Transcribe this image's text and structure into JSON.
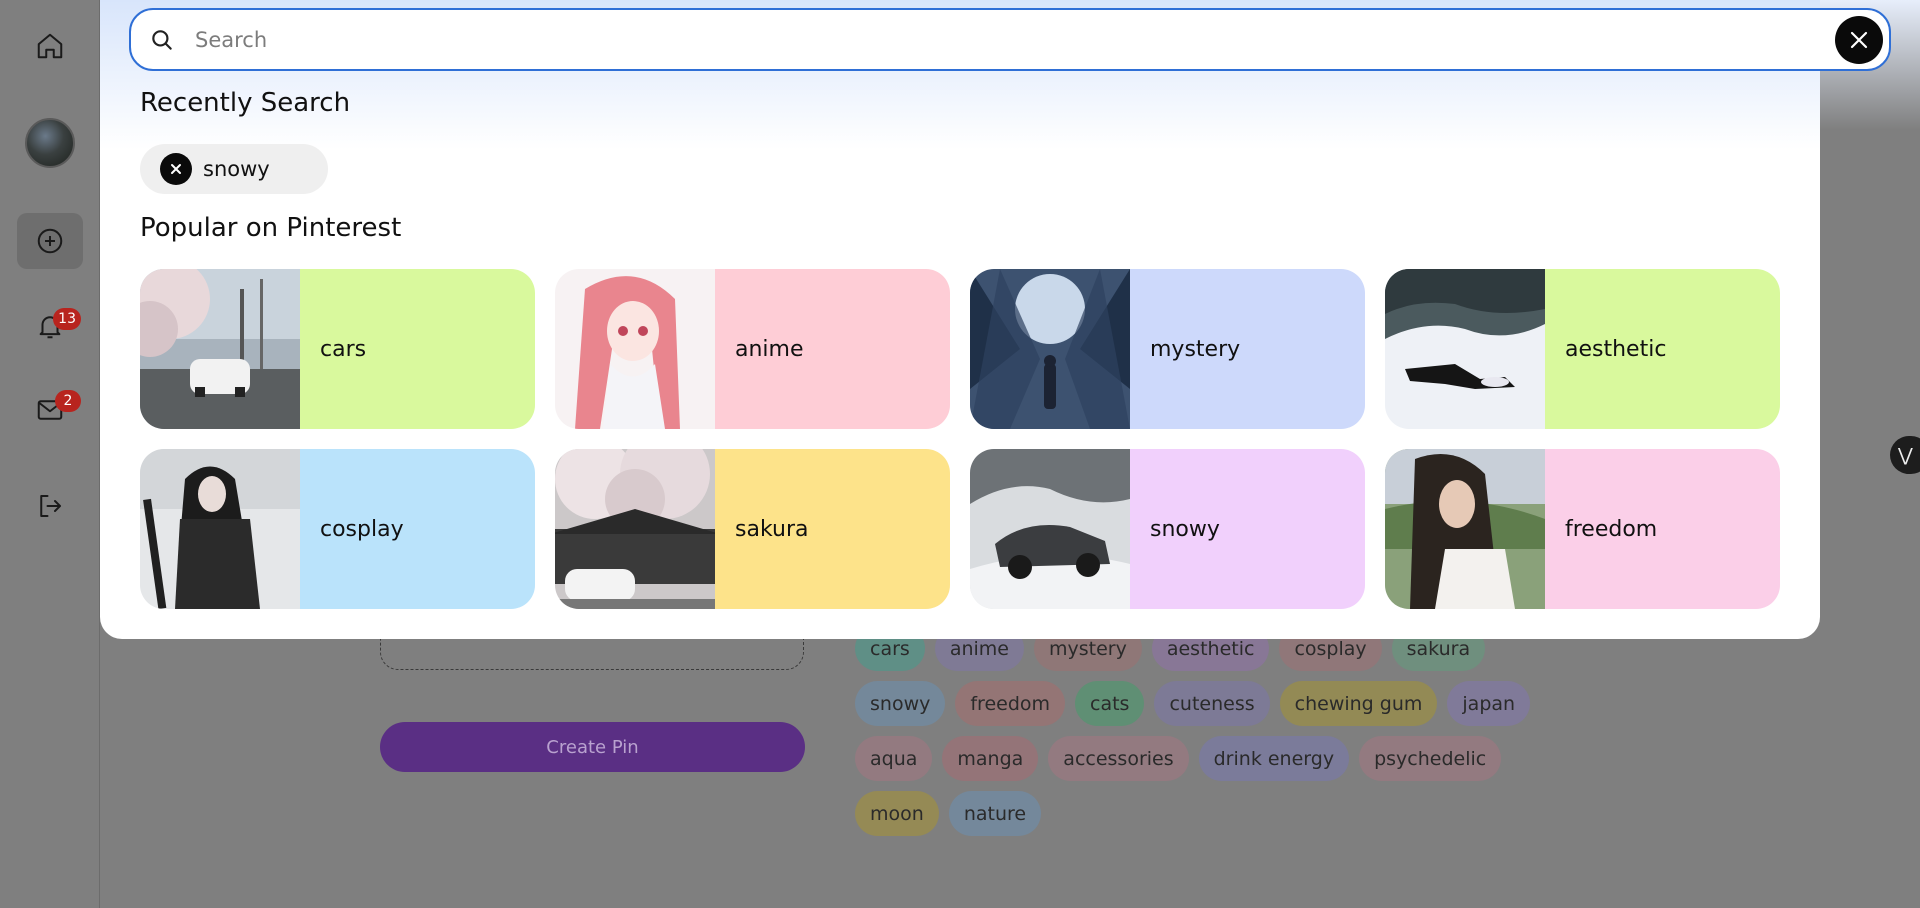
{
  "search": {
    "placeholder": "Search",
    "value": ""
  },
  "sidebar": {
    "notifications_badge": "13",
    "messages_badge": "2"
  },
  "recent": {
    "heading": "Recently Search",
    "items": [
      "snowy"
    ]
  },
  "popular": {
    "heading": "Popular on Pinterest",
    "items": [
      {
        "label": "cars",
        "color": "#d9f99d",
        "image": "white car under cherry blossoms"
      },
      {
        "label": "anime",
        "color": "#fecdd6",
        "image": "pink haired anime girl"
      },
      {
        "label": "mystery",
        "color": "#cdd9fb",
        "image": "figure in snowy forest"
      },
      {
        "label": "aesthetic",
        "color": "#d9f99d",
        "image": "person lying in snow"
      },
      {
        "label": "cosplay",
        "color": "#bae3fb",
        "image": "girl in snow"
      },
      {
        "label": "sakura",
        "color": "#fde38a",
        "image": "cherry blossoms over house"
      },
      {
        "label": "snowy",
        "color": "#f1d0fc",
        "image": "car in snow"
      },
      {
        "label": "freedom",
        "color": "#fbcfe8",
        "image": "girl with wind in hair"
      }
    ]
  },
  "background": {
    "create_pin": "Create Pin",
    "tags": [
      {
        "label": "cars",
        "color": "#5f8f86"
      },
      {
        "label": "anime",
        "color": "#7f7a95"
      },
      {
        "label": "mystery",
        "color": "#8f7777"
      },
      {
        "label": "aesthetic",
        "color": "#887796"
      },
      {
        "label": "cosplay",
        "color": "#907779"
      },
      {
        "label": "sakura",
        "color": "#6f8f7e"
      },
      {
        "label": "snowy",
        "color": "#74889a"
      },
      {
        "label": "freedom",
        "color": "#947575"
      },
      {
        "label": "cats",
        "color": "#5f8f74"
      },
      {
        "label": "cuteness",
        "color": "#7d7a96"
      },
      {
        "label": "chewing gum",
        "color": "#938a55"
      },
      {
        "label": "japan",
        "color": "#807a99"
      },
      {
        "label": "aqua",
        "color": "#937a80"
      },
      {
        "label": "manga",
        "color": "#947478"
      },
      {
        "label": "accessories",
        "color": "#937a80"
      },
      {
        "label": "drink energy",
        "color": "#7b7b9a"
      },
      {
        "label": "psychedelic",
        "color": "#937a80"
      },
      {
        "label": "moon",
        "color": "#958a55"
      },
      {
        "label": "nature",
        "color": "#74889b"
      }
    ]
  }
}
